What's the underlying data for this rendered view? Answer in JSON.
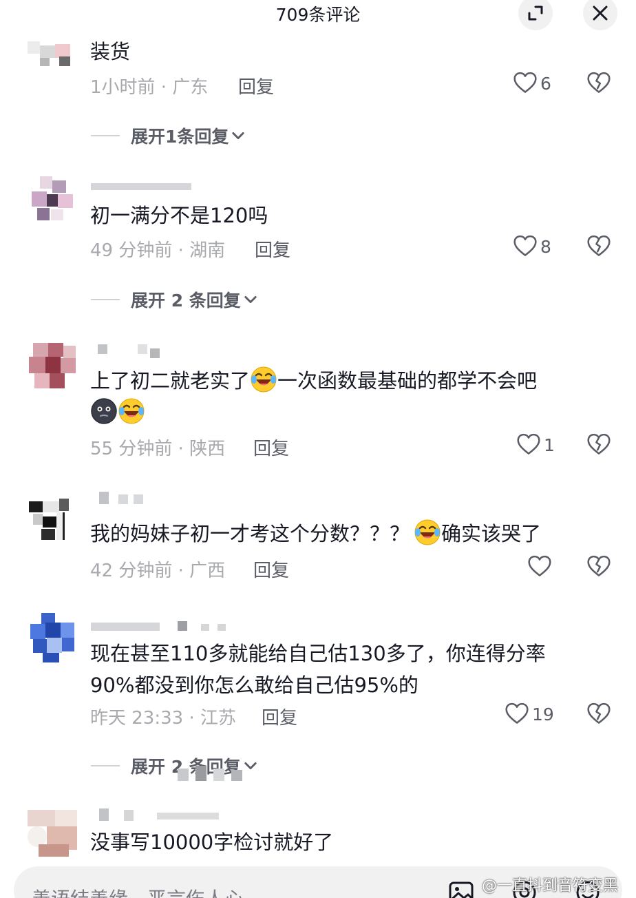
{
  "header": {
    "title": "709条评论"
  },
  "comments": [
    {
      "text": "装货",
      "time": "1小时前",
      "region": "广东",
      "reply": "回复",
      "likes": "6",
      "expand": "展开1条回复"
    },
    {
      "text": "初一满分不是120吗",
      "time": "49 分钟前",
      "region": "湖南",
      "reply": "回复",
      "likes": "8",
      "expand": "展开 2 条回复"
    },
    {
      "text_a": "上了初二就老实了",
      "text_b": "一次函数最基础的都学不会吧",
      "time": "55 分钟前",
      "region": "陕西",
      "reply": "回复",
      "likes": "1"
    },
    {
      "text_a": "我的妈妹子初一才考这个分数？？？",
      "text_b": "确实该哭了",
      "time": "42 分钟前",
      "region": "广西",
      "reply": "回复"
    },
    {
      "line1": "现在甚至110多就能给自己估130多了，你连得分率",
      "line2": "90%都没到你怎么敢给自己估95%的",
      "time": "昨天 23:33",
      "region": "江苏",
      "reply": "回复",
      "likes": "19",
      "expand": "展开 2 条回复"
    },
    {
      "text": "没事写10000字检讨就好了"
    }
  ],
  "composer": {
    "placeholder": "善语结善缘，恶言伤人心"
  },
  "watermark": "@一直抖到音符变黑",
  "colors": {
    "text": "#161823",
    "meta": "#a8a9ad",
    "secondary": "#5b5d66",
    "surface": "#f1f1f2"
  },
  "icons": [
    "expand-icon",
    "close-icon",
    "heart-icon",
    "broken-heart-icon",
    "chevron-down-icon",
    "image-icon",
    "mention-icon",
    "emoji-icon"
  ]
}
